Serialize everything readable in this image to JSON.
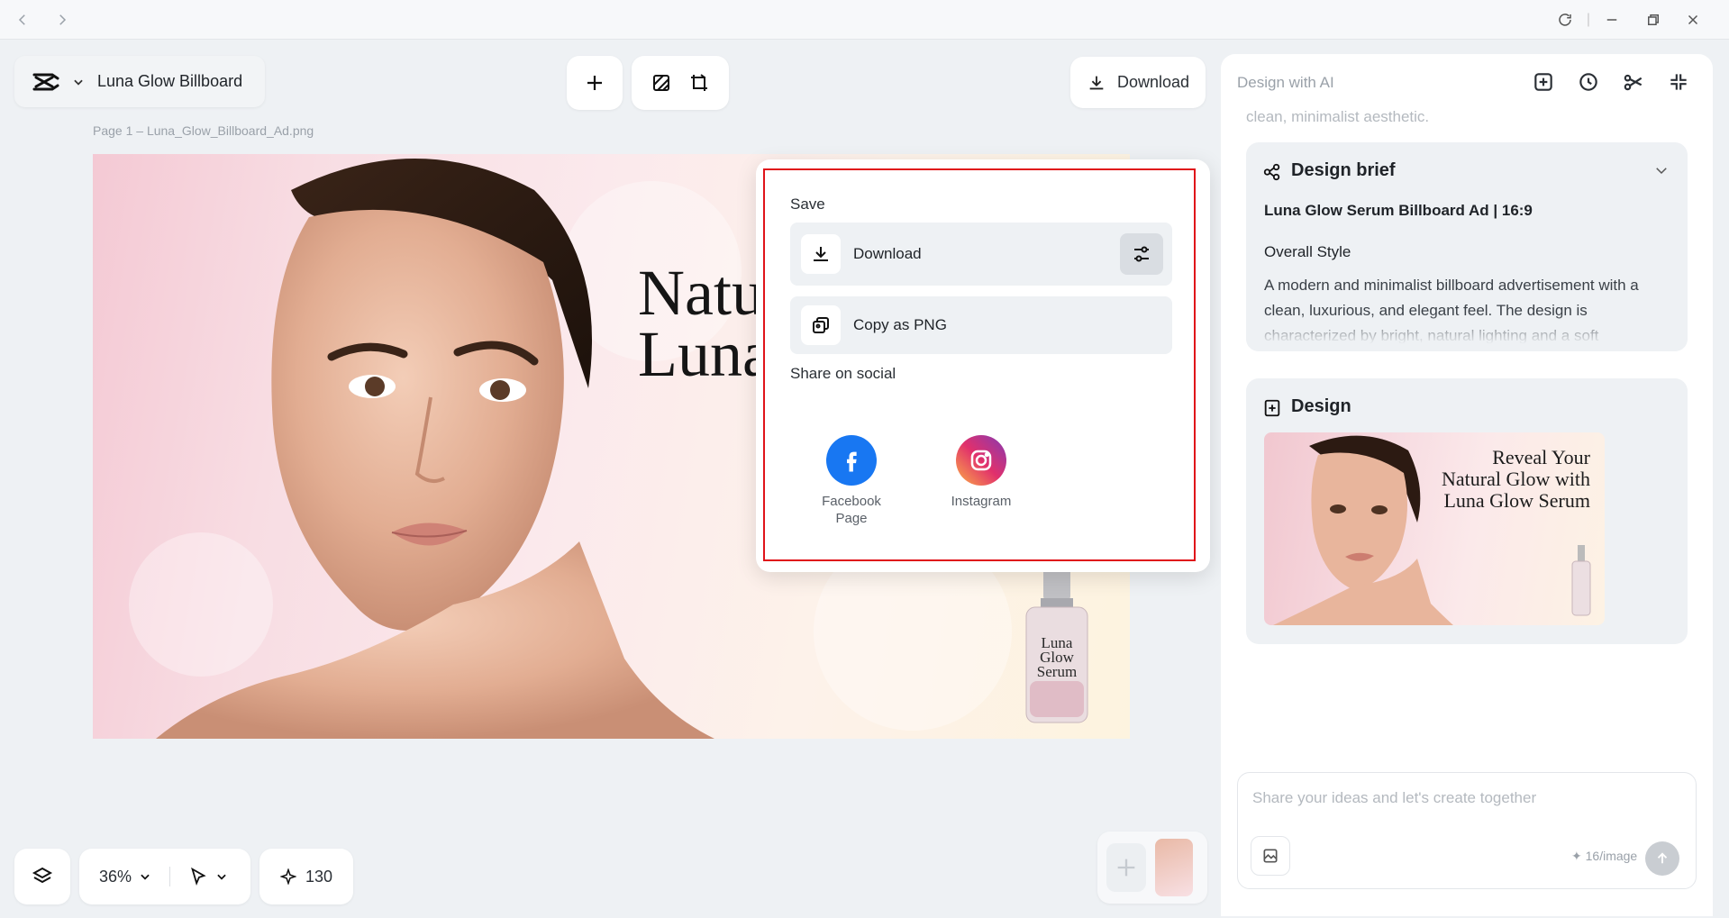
{
  "header": {
    "doc_title": "Luna Glow Billboard",
    "download_label": "Download",
    "page_label": "Page 1 –  Luna_Glow_Billboard_Ad.png"
  },
  "canvas": {
    "headline_line1": "Natu",
    "headline_line2": "Luna",
    "bottle_text": "Luna\nGlow\nSerum"
  },
  "popover": {
    "save_section": "Save",
    "download_label": "Download",
    "copy_label": "Copy as PNG",
    "share_section": "Share on social",
    "social": [
      {
        "label": "Facebook Page",
        "icon": "facebook-icon",
        "color": "#1877f2"
      },
      {
        "label": "Instagram",
        "icon": "instagram-icon",
        "color": "#e1306c"
      }
    ],
    "highlight_color": "#e0131a"
  },
  "toolbar": {
    "zoom": "36%",
    "credits": "130"
  },
  "ai_panel": {
    "title": "Design with AI",
    "faded_text": "clean, minimalist aesthetic.",
    "brief": {
      "title": "Design brief",
      "subtitle": "Luna Glow Serum Billboard Ad | 16:9",
      "heading": "Overall Style",
      "body": "A modern and minimalist billboard advertisement with a clean, luxurious, and elegant feel. The design is characterized by bright, natural lighting and a soft"
    },
    "design": {
      "title": "Design",
      "thumb_line1": "Reveal Your",
      "thumb_line2": "Natural Glow with",
      "thumb_line3": "Luna Glow Serum"
    },
    "chat": {
      "placeholder": "Share your ideas and let's create together",
      "cost": "16/image"
    }
  }
}
